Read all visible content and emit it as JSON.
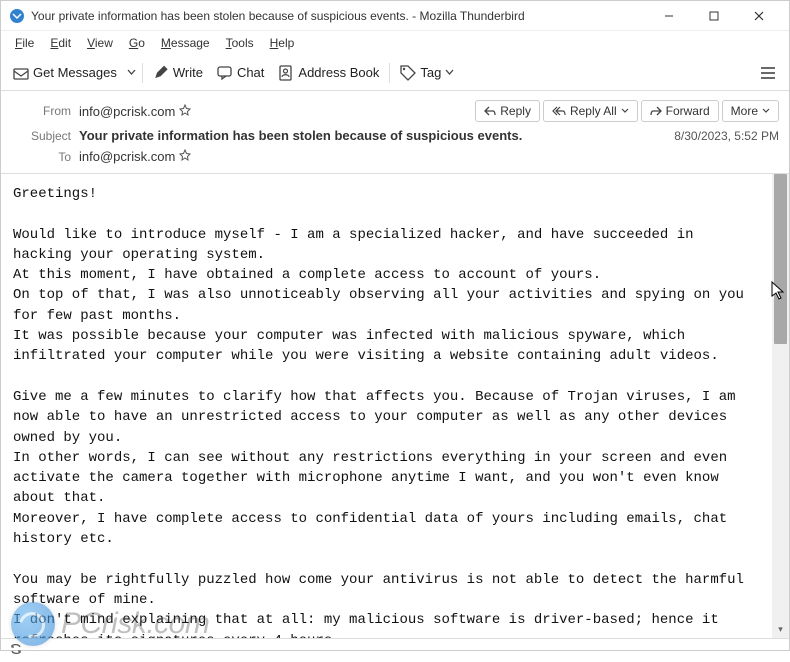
{
  "window": {
    "title": "Your private information has been stolen because of suspicious events. - Mozilla Thunderbird"
  },
  "menubar": {
    "file": "File",
    "edit": "Edit",
    "view": "View",
    "go": "Go",
    "message": "Message",
    "tools": "Tools",
    "help": "Help"
  },
  "toolbar": {
    "get_messages": "Get Messages",
    "write": "Write",
    "chat": "Chat",
    "address_book": "Address Book",
    "tag": "Tag"
  },
  "headers": {
    "from_label": "From",
    "from_value": "info@pcrisk.com",
    "subject_label": "Subject",
    "subject_value": "Your private information has been stolen because of suspicious events.",
    "to_label": "To",
    "to_value": "info@pcrisk.com",
    "date": "8/30/2023, 5:52 PM"
  },
  "actions": {
    "reply": "Reply",
    "reply_all": "Reply All",
    "forward": "Forward",
    "more": "More"
  },
  "message_body": "Greetings!\n\nWould like to introduce myself - I am a specialized hacker, and have succeeded in hacking your operating system.\nAt this moment, I have obtained a complete access to account of yours.\nOn top of that, I was also unnoticeably observing all your activities and spying on you for few past months.\nIt was possible because your computer was infected with malicious spyware, which infiltrated your computer while you were visiting a website containing adult videos.\n\nGive me a few minutes to clarify how that affects you. Because of Trojan viruses, I am now able to have an unrestricted access to your computer as well as any other devices owned by you.\nIn other words, I can see without any restrictions everything in your screen and even activate the camera together with microphone anytime I want, and you won't even know about that.\nMoreover, I have complete access to confidential data of yours including emails, chat history etc.\n\nYou may be rightfully puzzled how come your antivirus is not able to detect the harmful software of mine.\nI don't mind explaining that at all: my malicious software is driver-based; hence it refreshes its signatures every 4 hours,\nwhich makes it impossible for your antivirus to identify it.",
  "watermark": {
    "text": "PCrisk.com"
  }
}
